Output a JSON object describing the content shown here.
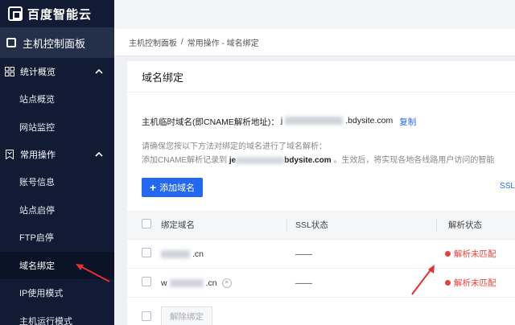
{
  "brand": {
    "name": "百度智能云"
  },
  "sidebar": {
    "console_label": "主机控制面板",
    "groups": [
      {
        "label": "统计概览",
        "items": [
          "站点概览",
          "网站监控"
        ]
      },
      {
        "label": "常用操作",
        "items": [
          "账号信息",
          "站点启停",
          "FTP启停",
          "域名绑定",
          "IP使用模式",
          "主机运行模式"
        ]
      }
    ],
    "active_item": "域名绑定"
  },
  "breadcrumb": {
    "home": "主机控制面板",
    "separator": "/",
    "current": "常用操作 - 域名绑定"
  },
  "panel": {
    "title": "域名绑定",
    "temp_domain_label": "主机临时域名(即CNAME解析地址)：",
    "temp_domain_prefix": "j",
    "temp_domain_suffix": ".bdysite.com",
    "copy_label": "复制",
    "hint_line1": "请确保您按以下方法对绑定的域名进行了域名解析：",
    "hint_line2_prefix": "添加CNAME解析记录到",
    "hint_line2_domain_prefix": "je",
    "hint_line2_domain_suffix": "bdysite.com",
    "hint_line2_rest": "。生效后，将实现各地各线路用户访问的智能",
    "add_button": "添加域名",
    "ssl_link": "SSL"
  },
  "table": {
    "headers": {
      "domain": "绑定域名",
      "ssl": "SSL状态",
      "status": "解析状态"
    },
    "rows": [
      {
        "domain_suffix": ".cn",
        "ssl": "——",
        "status": "解析未匹配",
        "prefix": ""
      },
      {
        "domain_suffix": ".cn",
        "ssl": "——",
        "status": "解析未匹配",
        "prefix": "w"
      }
    ],
    "unbind_button": "解除绑定"
  },
  "colors": {
    "accent": "#2468f2",
    "error": "#e8413b",
    "sidebar_bg": "#111c34"
  }
}
